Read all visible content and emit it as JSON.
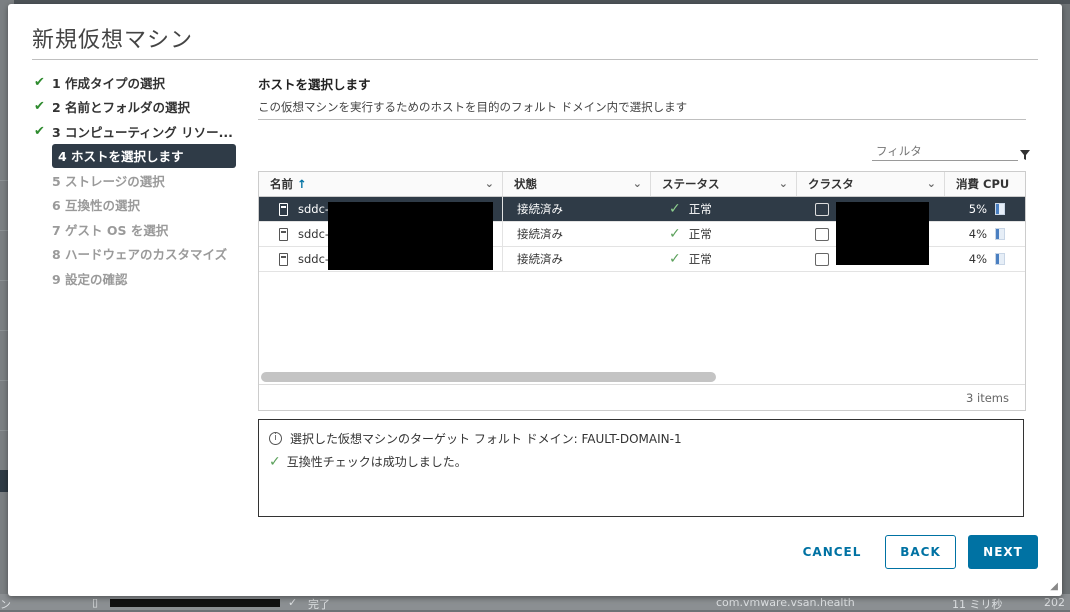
{
  "dialog": {
    "title": "新規仮想マシン"
  },
  "steps": [
    {
      "label": "1 作成タイプの選択",
      "state": "done"
    },
    {
      "label": "2 名前とフォルダの選択",
      "state": "done"
    },
    {
      "label": "3 コンピューティング リソー...",
      "state": "done"
    },
    {
      "label": "4 ホストを選択します",
      "state": "active"
    },
    {
      "label": "5 ストレージの選択",
      "state": "todo"
    },
    {
      "label": "6 互換性の選択",
      "state": "todo"
    },
    {
      "label": "7 ゲスト OS を選択",
      "state": "todo"
    },
    {
      "label": "8 ハードウェアのカスタマイズ",
      "state": "todo"
    },
    {
      "label": "9 設定の確認",
      "state": "todo"
    }
  ],
  "content": {
    "title": "ホストを選択します",
    "subtitle": "この仮想マシンを実行するためのホストを目的のフォルト ドメイン内で選択します",
    "filter_placeholder": "フィルタ"
  },
  "grid": {
    "columns": [
      "名前",
      "状態",
      "ステータス",
      "クラスタ",
      "消費 CPU"
    ],
    "rows": [
      {
        "name": "sddc-",
        "state": "接続済み",
        "status": "正常",
        "cpu": "5%",
        "cpu_fraction": 0.05,
        "selected": true
      },
      {
        "name": "sddc-",
        "state": "接続済み",
        "status": "正常",
        "cpu": "4%",
        "cpu_fraction": 0.04,
        "selected": false
      },
      {
        "name": "sddc-",
        "state": "接続済み",
        "status": "正常",
        "cpu": "4%",
        "cpu_fraction": 0.04,
        "selected": false
      }
    ],
    "footer": "3 items"
  },
  "messages": {
    "info": "選択した仮想マシンのターゲット フォルト ドメイン: FAULT-DOMAIN-1",
    "success": "互換性チェックは成功しました。"
  },
  "buttons": {
    "cancel": "CANCEL",
    "back": "BACK",
    "next": "NEXT"
  },
  "background": {
    "bottom_task": "com.vmware.vsan.health",
    "bottom_status": "完了",
    "bottom_time": "11 ミリ秒",
    "bottom_left": "ン",
    "bottom_right": "202"
  },
  "colors": {
    "accent": "#0072a3",
    "selected_row": "#2f3b47",
    "success": "#2e8b2e"
  }
}
